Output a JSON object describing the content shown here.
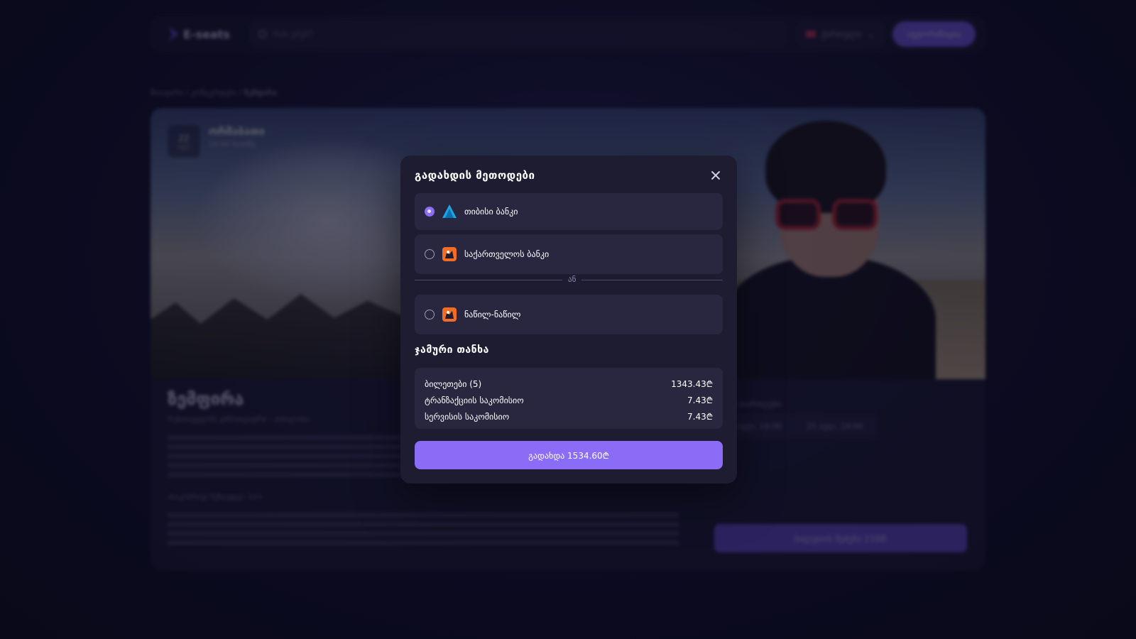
{
  "header": {
    "logo_text": "E-seats",
    "search_placeholder": "რას ეძებ?",
    "language": "ქართული",
    "login_label": "ავტორიზაცია"
  },
  "breadcrumb": {
    "home": "მთავარი",
    "category": "კონცერტები",
    "current": "ზემფირა"
  },
  "event": {
    "date_day": "22",
    "date_month": "ივლ",
    "weekday": "ორშაბათი",
    "time": "19:00 საათზე",
    "title": "ზემფირა",
    "place": "რუსთაველის კინოთეატრი - თბილისი",
    "age_limit": "ასაკობრივი შეზღუდვა: 12+",
    "dates_heading": "სხვა თარიღები",
    "date_chip_1": "22 ივლ, 19:00",
    "date_chip_2": "25 ივლ, 19:00",
    "buy_label": "ბილეთის შეძენა 210₾"
  },
  "modal": {
    "title": "გადახდის მეთოდები",
    "options": [
      {
        "label": "თიბისი ბანკი",
        "icon": "tbc-bank-icon",
        "selected": true
      },
      {
        "label": "საქართველოს ბანკი",
        "icon": "bank-of-georgia-icon",
        "selected": false
      },
      {
        "label": "ნაწილ-ნაწილ",
        "icon": "bank-of-georgia-icon",
        "selected": false
      }
    ],
    "or_text": "ან",
    "total_title": "ჯამური თანხა",
    "summary": [
      {
        "label": "ბილეთები (5)",
        "value": "1343.43₾"
      },
      {
        "label": "ტრანზაქციის საკომისიო",
        "value": "7.43₾"
      },
      {
        "label": "სერვისის საკომისიო",
        "value": "7.43₾"
      }
    ],
    "pay_label": "გადახდა 1534.60₾"
  },
  "colors": {
    "accent": "#8b6cf7",
    "modal_bg": "#1d1c31",
    "option_bg": "#28273f",
    "page_bg": "#0e0d26"
  }
}
